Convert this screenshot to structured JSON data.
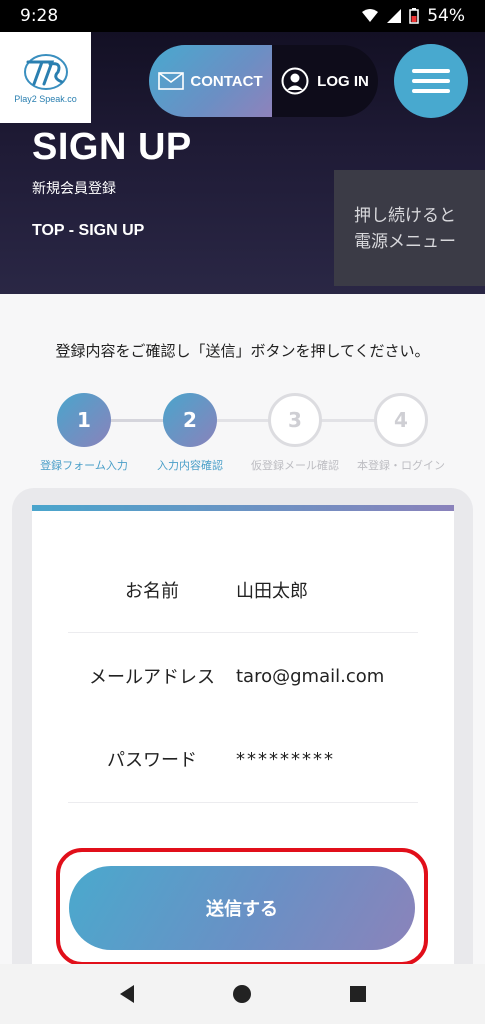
{
  "status_bar": {
    "time": "9:28",
    "battery": "54%"
  },
  "logo": {
    "caption": "Play2 Speak.co"
  },
  "nav": {
    "contact_label": "CONTACT",
    "login_label": "LOG IN"
  },
  "page": {
    "title": "SIGN UP",
    "subtitle": "新規会員登録",
    "breadcrumb": "TOP - SIGN UP"
  },
  "toast": {
    "line1": "押し続けると",
    "line2": "電源メニュー"
  },
  "instruction": "登録内容をご確認し「送信」ボタンを押してください。",
  "steps": [
    {
      "number": "1",
      "label": "登録フォーム入力",
      "active": true
    },
    {
      "number": "2",
      "label": "入力内容確認",
      "active": true
    },
    {
      "number": "3",
      "label": "仮登録メール確認",
      "active": false
    },
    {
      "number": "4",
      "label": "本登録・ログイン",
      "active": false
    }
  ],
  "form": {
    "name_label": "お名前",
    "name_value": "山田太郎",
    "email_label": "メールアドレス",
    "email_value": "taro@gmail.com",
    "password_label": "パスワード",
    "password_value": "*********"
  },
  "submit_label": "送信する",
  "colors": {
    "accent_start": "#4aa5cc",
    "accent_end": "#8a82bb",
    "highlight": "#e10f1a"
  }
}
